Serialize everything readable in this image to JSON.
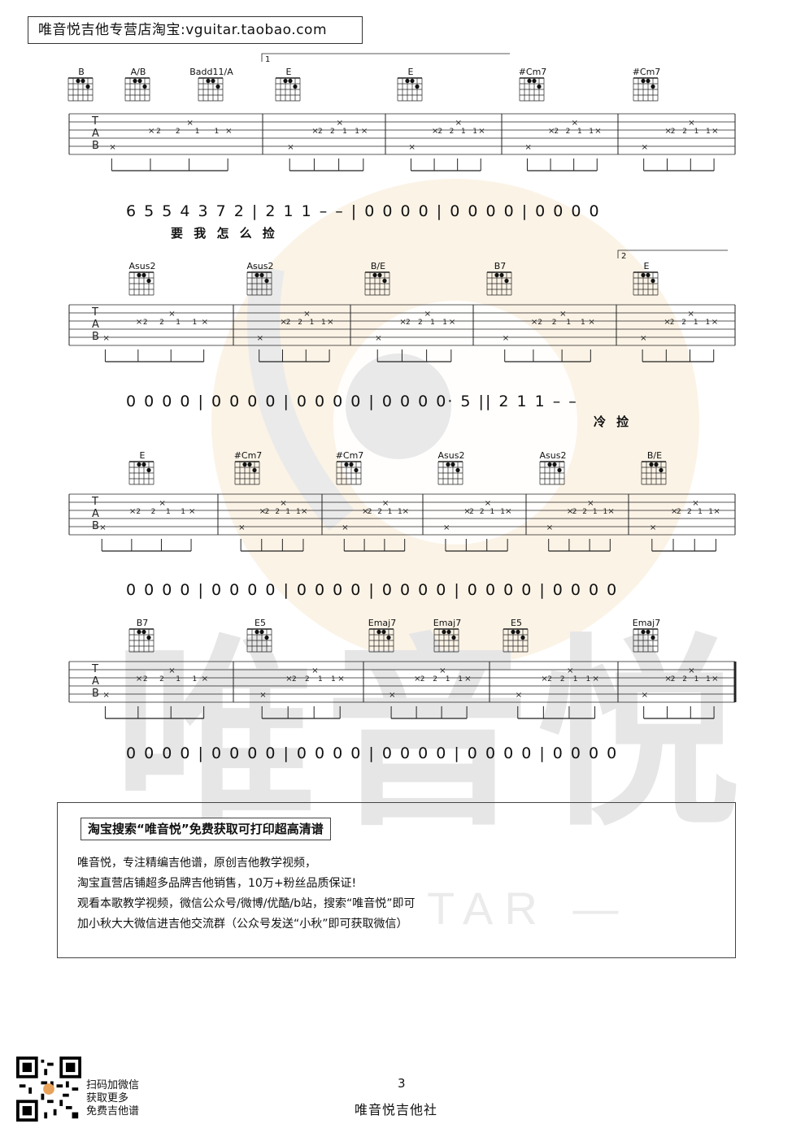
{
  "header": {
    "shop_label": "唯音悦吉他专营店淘宝:vguitar.taobao.com"
  },
  "watermark": {
    "brand": "唯音悦",
    "sub": "TAR —"
  },
  "systems": [
    {
      "chords": [
        "B",
        "A/B",
        "Badd11/A",
        "E",
        "E",
        "#Cm7",
        "#Cm7"
      ],
      "volta": "1",
      "numbers": "6 5 5 4 3  7 2 | 2 1 1  –  – | 0 0 0 0 | 0 0 0 0 | 0 0 0 0",
      "lyrics": "要 我 怎 么    捡"
    },
    {
      "chords": [
        "Asus2",
        "Asus2",
        "B/E",
        "B7",
        "E"
      ],
      "volta": "2",
      "numbers": "0 0 0 0 | 0 0 0 0 | 0 0 0 0 | 0 0 0 0· 5 || 2 1 1  –  –",
      "lyrics": "冷    捡"
    },
    {
      "chords": [
        "E",
        "#Cm7",
        "#Cm7",
        "Asus2",
        "Asus2",
        "B/E"
      ],
      "numbers": "0 0 0 0 | 0 0 0 0 | 0 0 0 0 | 0 0 0 0 | 0 0 0 0 | 0 0 0 0"
    },
    {
      "chords": [
        "B7",
        "E5",
        "Emaj7",
        "Emaj7",
        "E5",
        "Emaj7"
      ],
      "numbers": "0 0 0 0 | 0 0 0 0 | 0 0 0 0 | 0 0 0 0 | 0 0 0 0 | 0 0 0 0"
    }
  ],
  "promo": {
    "title": "淘宝搜索“唯音悦”免费获取可打印超高清谱",
    "lines": [
      "唯音悦，专注精编吉他谱，原创吉他教学视频，",
      "淘宝直营店铺超多品牌吉他销售，10万+粉丝品质保证!",
      "观看本歌教学视频，微信公众号/微博/优酷/b站，搜索“唯音悦”即可",
      "加小秋大大微信进吉他交流群（公众号发送“小秋”即可获取微信）"
    ]
  },
  "footer": {
    "qr_caption": [
      "扫码加微信",
      "获取更多",
      "免费吉他谱"
    ],
    "page_number": "3",
    "publisher": "唯音悦吉他社"
  }
}
